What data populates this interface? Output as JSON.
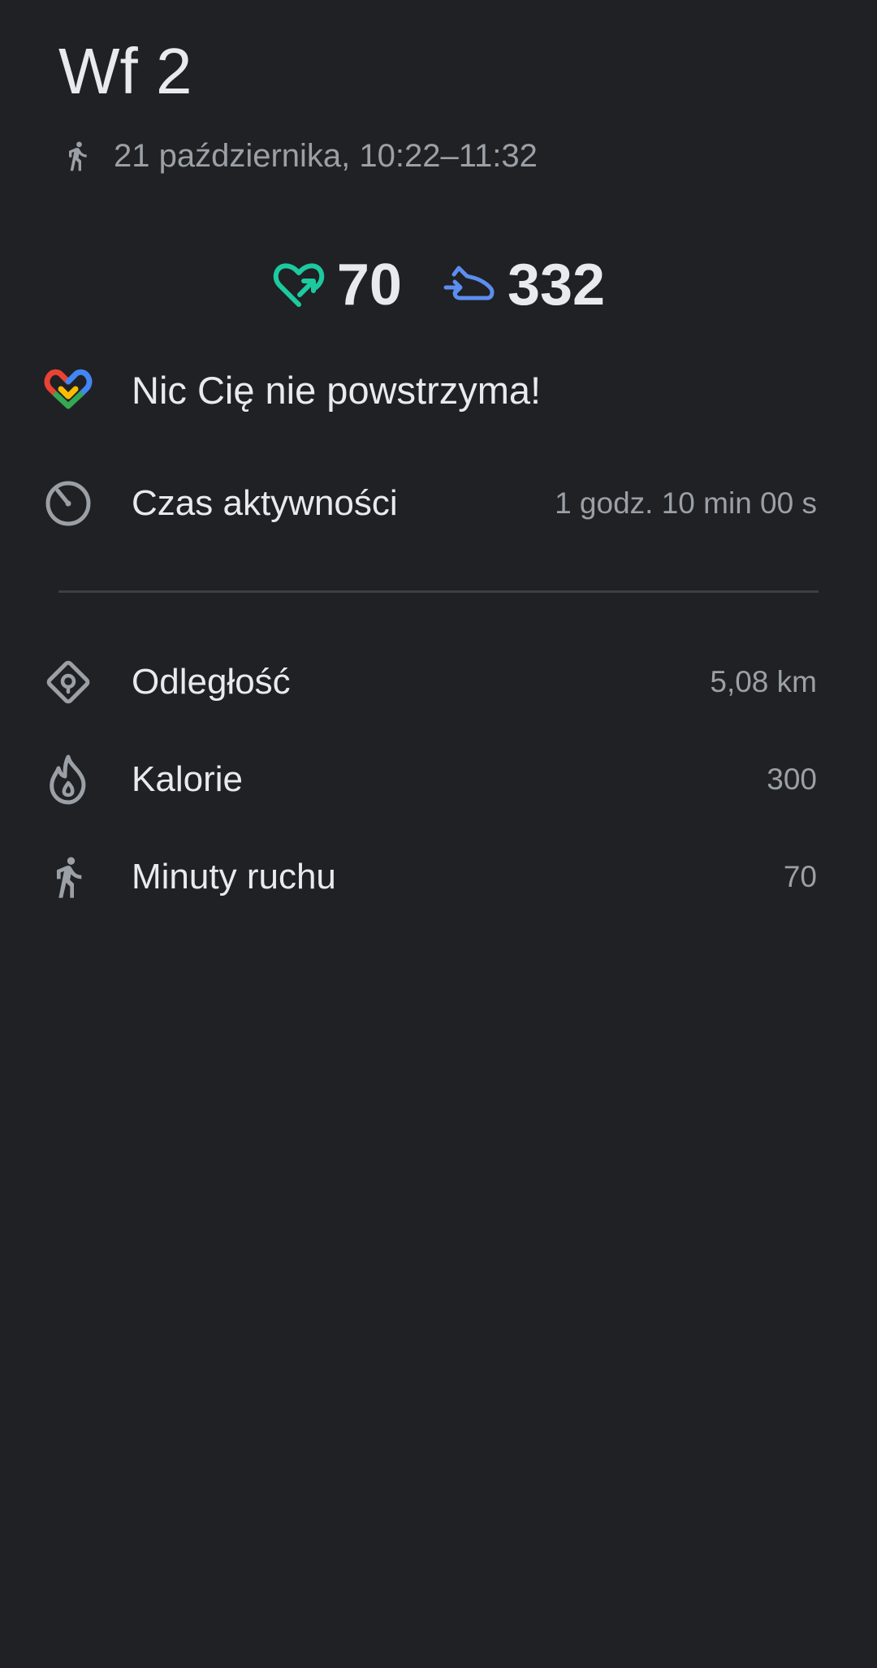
{
  "header": {
    "title": "Wf 2",
    "date_time": "21 października, 10:22–11:32",
    "activity_icon": "walking-person-icon"
  },
  "summary": {
    "heart_points": {
      "icon": "heart-points-icon",
      "value": "70",
      "color": "#1ccaa0"
    },
    "steps": {
      "icon": "steps-shoe-icon",
      "value": "332",
      "color": "#5c8ef0"
    }
  },
  "motivation": {
    "icon": "google-fit-logo-icon",
    "text": "Nic Cię nie powstrzyma!"
  },
  "active_time": {
    "icon": "timer-icon",
    "label": "Czas aktywności",
    "value": "1 godz. 10 min 00 s"
  },
  "metrics": [
    {
      "icon": "distance-icon",
      "label": "Odległość",
      "value": "5,08 km"
    },
    {
      "icon": "calories-flame-icon",
      "label": "Kalorie",
      "value": "300"
    },
    {
      "icon": "walking-person-icon",
      "label": "Minuty ruchu",
      "value": "70"
    }
  ],
  "colors": {
    "background": "#202124",
    "primary_text": "#e8eaed",
    "secondary_text": "#9aa0a6",
    "icon_gray": "#9aa0a6",
    "divider": "#3c4043"
  }
}
